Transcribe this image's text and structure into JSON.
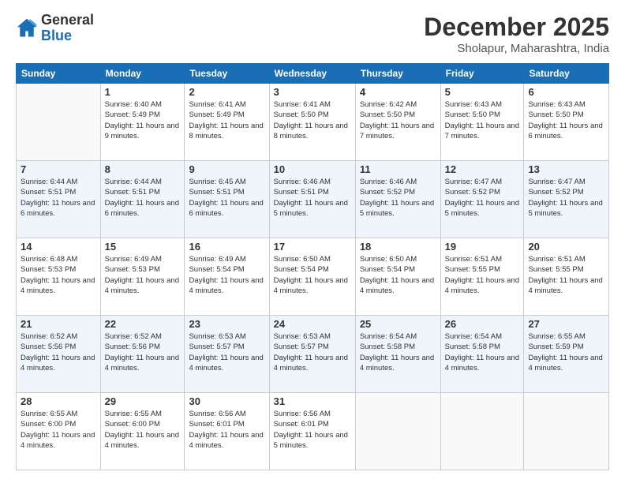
{
  "header": {
    "logo_line1": "General",
    "logo_line2": "Blue",
    "month": "December 2025",
    "location": "Sholapur, Maharashtra, India"
  },
  "weekdays": [
    "Sunday",
    "Monday",
    "Tuesday",
    "Wednesday",
    "Thursday",
    "Friday",
    "Saturday"
  ],
  "weeks": [
    [
      {
        "day": "",
        "sunrise": "",
        "sunset": "",
        "daylight": ""
      },
      {
        "day": "1",
        "sunrise": "Sunrise: 6:40 AM",
        "sunset": "Sunset: 5:49 PM",
        "daylight": "Daylight: 11 hours and 9 minutes."
      },
      {
        "day": "2",
        "sunrise": "Sunrise: 6:41 AM",
        "sunset": "Sunset: 5:49 PM",
        "daylight": "Daylight: 11 hours and 8 minutes."
      },
      {
        "day": "3",
        "sunrise": "Sunrise: 6:41 AM",
        "sunset": "Sunset: 5:50 PM",
        "daylight": "Daylight: 11 hours and 8 minutes."
      },
      {
        "day": "4",
        "sunrise": "Sunrise: 6:42 AM",
        "sunset": "Sunset: 5:50 PM",
        "daylight": "Daylight: 11 hours and 7 minutes."
      },
      {
        "day": "5",
        "sunrise": "Sunrise: 6:43 AM",
        "sunset": "Sunset: 5:50 PM",
        "daylight": "Daylight: 11 hours and 7 minutes."
      },
      {
        "day": "6",
        "sunrise": "Sunrise: 6:43 AM",
        "sunset": "Sunset: 5:50 PM",
        "daylight": "Daylight: 11 hours and 6 minutes."
      }
    ],
    [
      {
        "day": "7",
        "sunrise": "Sunrise: 6:44 AM",
        "sunset": "Sunset: 5:51 PM",
        "daylight": "Daylight: 11 hours and 6 minutes."
      },
      {
        "day": "8",
        "sunrise": "Sunrise: 6:44 AM",
        "sunset": "Sunset: 5:51 PM",
        "daylight": "Daylight: 11 hours and 6 minutes."
      },
      {
        "day": "9",
        "sunrise": "Sunrise: 6:45 AM",
        "sunset": "Sunset: 5:51 PM",
        "daylight": "Daylight: 11 hours and 6 minutes."
      },
      {
        "day": "10",
        "sunrise": "Sunrise: 6:46 AM",
        "sunset": "Sunset: 5:51 PM",
        "daylight": "Daylight: 11 hours and 5 minutes."
      },
      {
        "day": "11",
        "sunrise": "Sunrise: 6:46 AM",
        "sunset": "Sunset: 5:52 PM",
        "daylight": "Daylight: 11 hours and 5 minutes."
      },
      {
        "day": "12",
        "sunrise": "Sunrise: 6:47 AM",
        "sunset": "Sunset: 5:52 PM",
        "daylight": "Daylight: 11 hours and 5 minutes."
      },
      {
        "day": "13",
        "sunrise": "Sunrise: 6:47 AM",
        "sunset": "Sunset: 5:52 PM",
        "daylight": "Daylight: 11 hours and 5 minutes."
      }
    ],
    [
      {
        "day": "14",
        "sunrise": "Sunrise: 6:48 AM",
        "sunset": "Sunset: 5:53 PM",
        "daylight": "Daylight: 11 hours and 4 minutes."
      },
      {
        "day": "15",
        "sunrise": "Sunrise: 6:49 AM",
        "sunset": "Sunset: 5:53 PM",
        "daylight": "Daylight: 11 hours and 4 minutes."
      },
      {
        "day": "16",
        "sunrise": "Sunrise: 6:49 AM",
        "sunset": "Sunset: 5:54 PM",
        "daylight": "Daylight: 11 hours and 4 minutes."
      },
      {
        "day": "17",
        "sunrise": "Sunrise: 6:50 AM",
        "sunset": "Sunset: 5:54 PM",
        "daylight": "Daylight: 11 hours and 4 minutes."
      },
      {
        "day": "18",
        "sunrise": "Sunrise: 6:50 AM",
        "sunset": "Sunset: 5:54 PM",
        "daylight": "Daylight: 11 hours and 4 minutes."
      },
      {
        "day": "19",
        "sunrise": "Sunrise: 6:51 AM",
        "sunset": "Sunset: 5:55 PM",
        "daylight": "Daylight: 11 hours and 4 minutes."
      },
      {
        "day": "20",
        "sunrise": "Sunrise: 6:51 AM",
        "sunset": "Sunset: 5:55 PM",
        "daylight": "Daylight: 11 hours and 4 minutes."
      }
    ],
    [
      {
        "day": "21",
        "sunrise": "Sunrise: 6:52 AM",
        "sunset": "Sunset: 5:56 PM",
        "daylight": "Daylight: 11 hours and 4 minutes."
      },
      {
        "day": "22",
        "sunrise": "Sunrise: 6:52 AM",
        "sunset": "Sunset: 5:56 PM",
        "daylight": "Daylight: 11 hours and 4 minutes."
      },
      {
        "day": "23",
        "sunrise": "Sunrise: 6:53 AM",
        "sunset": "Sunset: 5:57 PM",
        "daylight": "Daylight: 11 hours and 4 minutes."
      },
      {
        "day": "24",
        "sunrise": "Sunrise: 6:53 AM",
        "sunset": "Sunset: 5:57 PM",
        "daylight": "Daylight: 11 hours and 4 minutes."
      },
      {
        "day": "25",
        "sunrise": "Sunrise: 6:54 AM",
        "sunset": "Sunset: 5:58 PM",
        "daylight": "Daylight: 11 hours and 4 minutes."
      },
      {
        "day": "26",
        "sunrise": "Sunrise: 6:54 AM",
        "sunset": "Sunset: 5:58 PM",
        "daylight": "Daylight: 11 hours and 4 minutes."
      },
      {
        "day": "27",
        "sunrise": "Sunrise: 6:55 AM",
        "sunset": "Sunset: 5:59 PM",
        "daylight": "Daylight: 11 hours and 4 minutes."
      }
    ],
    [
      {
        "day": "28",
        "sunrise": "Sunrise: 6:55 AM",
        "sunset": "Sunset: 6:00 PM",
        "daylight": "Daylight: 11 hours and 4 minutes."
      },
      {
        "day": "29",
        "sunrise": "Sunrise: 6:55 AM",
        "sunset": "Sunset: 6:00 PM",
        "daylight": "Daylight: 11 hours and 4 minutes."
      },
      {
        "day": "30",
        "sunrise": "Sunrise: 6:56 AM",
        "sunset": "Sunset: 6:01 PM",
        "daylight": "Daylight: 11 hours and 4 minutes."
      },
      {
        "day": "31",
        "sunrise": "Sunrise: 6:56 AM",
        "sunset": "Sunset: 6:01 PM",
        "daylight": "Daylight: 11 hours and 5 minutes."
      },
      {
        "day": "",
        "sunrise": "",
        "sunset": "",
        "daylight": ""
      },
      {
        "day": "",
        "sunrise": "",
        "sunset": "",
        "daylight": ""
      },
      {
        "day": "",
        "sunrise": "",
        "sunset": "",
        "daylight": ""
      }
    ]
  ]
}
